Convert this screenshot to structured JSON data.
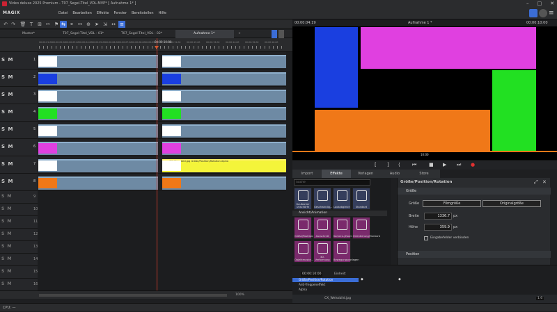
{
  "window": {
    "title": "Video deluxe 2025 Premium - T07_Segel-Titel_VDL.MVP* [ Aufnahme 1* ]"
  },
  "app": {
    "logo": "MAGIX"
  },
  "menu": [
    "Datei",
    "Bearbeiten",
    "Effekte",
    "Fenster",
    "Bereitstellen",
    "Hilfe"
  ],
  "tabs": [
    "Muster*",
    "T07_Segel-Titel_VDL - 01*",
    "T07_Segel-Titel_VDL - 02*",
    "Aufnahme 1*"
  ],
  "timeline": {
    "playhead_tc": "00:00:10:00",
    "ruler_labels": [
      "00:00:01:00",
      "00:00:02:00",
      "00:00:03:00",
      "00:00:04:00",
      "00:00:05:00",
      "00:00:06:00",
      "00:00:07:00",
      "00:00:08:00",
      "00:00:09:00",
      "00:00:11:00",
      "00:00:12:00",
      "00:00:13:00",
      "00:00:14:00",
      "00:00:15:00",
      "00:00:16:00"
    ],
    "track_smr": "S M",
    "tracks": [
      {
        "num": "1",
        "color": "#ffffff"
      },
      {
        "num": "2",
        "color": "#1a3fe0"
      },
      {
        "num": "3",
        "color": "#ffffff"
      },
      {
        "num": "4",
        "color": "#22e022"
      },
      {
        "num": "5",
        "color": "#ffffff"
      },
      {
        "num": "6",
        "color": "#e040e0"
      },
      {
        "num": "7",
        "color": "#ffffff"
      },
      {
        "num": "8",
        "color": "#f07818"
      }
    ],
    "clip7_label": "CX_Weissbild.jpg   Größe/Position/Rotation   Alpha",
    "empty_tracks": [
      "9",
      "10",
      "11",
      "12",
      "13",
      "14",
      "15",
      "16"
    ],
    "zoom": "100%"
  },
  "preview": {
    "tc_left": "00:00:04:19",
    "title": "Aufnahme 1 *",
    "tc_right": "00:00:10:00",
    "scrub_tc": "10:00"
  },
  "panel_tabs": [
    "Import",
    "Effekte",
    "Vorlagen",
    "Audio",
    "Store"
  ],
  "effects": {
    "search_placeholder": "Suche",
    "row1": [
      "Gaußscher Unschärfe",
      "Geschwindig...",
      "Lookabgleich",
      "Standard"
    ],
    "section": "Ansicht/Animation",
    "row2": [
      "Größe/Position/Rot...",
      "Ausschnitt",
      "Kamera-/Zoomfahrt",
      "Orientierung/Horizont"
    ],
    "row3": [
      "Objektmaske...",
      "3D-Verformung",
      "Bewegungsvorlagen"
    ]
  },
  "props": {
    "header": "Größe/Position/Rotation",
    "section_size": "Größe",
    "label_size": "Größe",
    "btn_film": "Filmgröße",
    "btn_orig": "Originalgröße",
    "label_width": "Breite",
    "width": "1336.7",
    "label_height": "Höhe",
    "height": "359.9",
    "unit": "px",
    "link_label": "Eingabefelder verbinden",
    "section_position": "Position"
  },
  "keyframes": {
    "tc": "00:00:10:00",
    "einheit": "Einheit:",
    "rows": [
      "Größe/Position/Rotation",
      "Anti-Treppeneffekt",
      "Alpha"
    ]
  },
  "kf_bottom": {
    "file": "CX_Weissbild.jpg",
    "page": "1.6"
  },
  "status": {
    "cpu": "CPU: —"
  },
  "colors": {
    "blue": "#1a3fe0",
    "magenta": "#e040e0",
    "green": "#22e022",
    "orange": "#f07818",
    "yellow": "#f4f43a",
    "clip": "#6e8aa4"
  }
}
